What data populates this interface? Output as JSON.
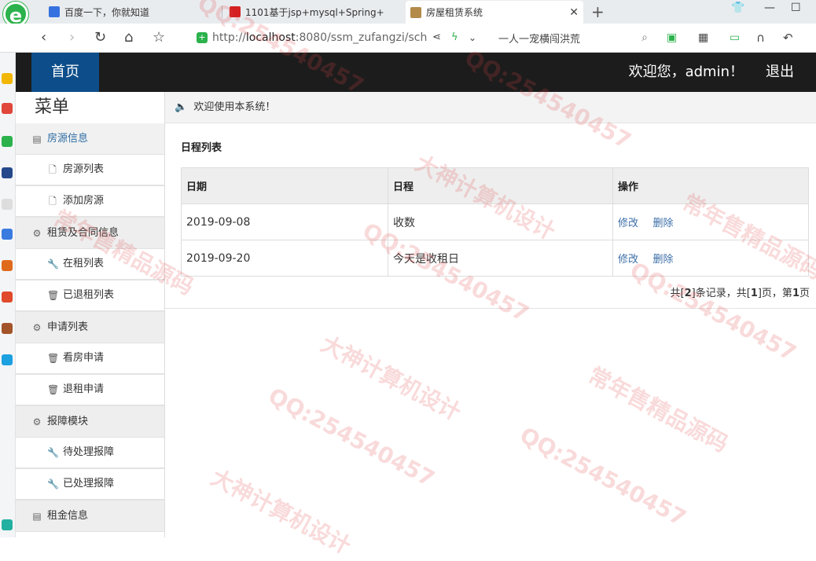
{
  "browser": {
    "tabs": [
      {
        "title": "百度一下，你就知道",
        "color": "#3572e0"
      },
      {
        "title": "1101基于jsp+mysql+Spring+",
        "color": "#d42020"
      },
      {
        "title": "房屋租赁系统",
        "color": "#b38a4a",
        "close": "✕"
      }
    ],
    "new_tab": "+",
    "url_prefix": "http://",
    "url_host": "localhost",
    "url_rest": ":8080/ssm_zufangzi/sch",
    "search_text": "一人一宠横闯洪荒"
  },
  "header": {
    "home": "首页",
    "welcome": "欢迎您，admin！",
    "logout": "退出"
  },
  "sidebar": {
    "title": "菜单",
    "groups": [
      {
        "label": "房源信息",
        "icon": "list-icon",
        "items": [
          {
            "label": "房源列表",
            "icon": "file-icon"
          },
          {
            "label": "添加房源",
            "icon": "file-icon"
          }
        ]
      },
      {
        "label": "租赁及合同信息",
        "icon": "gear-icon",
        "items": [
          {
            "label": "在租列表",
            "icon": "wrench-icon"
          },
          {
            "label": "已退租列表",
            "icon": "trash-icon"
          }
        ]
      },
      {
        "label": "申请列表",
        "icon": "gear-icon",
        "items": [
          {
            "label": "看房申请",
            "icon": "trash-icon"
          },
          {
            "label": "退租申请",
            "icon": "trash-icon"
          }
        ]
      },
      {
        "label": "报障模块",
        "icon": "gear-icon",
        "items": [
          {
            "label": "待处理报障",
            "icon": "wrench-icon"
          },
          {
            "label": "已处理报障",
            "icon": "wrench-icon"
          }
        ]
      },
      {
        "label": "租金信息",
        "icon": "list-icon",
        "items": []
      }
    ]
  },
  "notice": "欢迎使用本系统！",
  "main": {
    "title": "日程列表",
    "columns": [
      "日期",
      "日程",
      "操作"
    ],
    "rows": [
      {
        "date": "2019-09-08",
        "event": "收数",
        "edit": "修改",
        "delete": "删除"
      },
      {
        "date": "2019-09-20",
        "event": "今天是收租日",
        "edit": "修改",
        "delete": "删除"
      }
    ],
    "pager": {
      "p1": "共[",
      "total": "2",
      "p2": "]条记录，共[",
      "pages": "1",
      "p3": "]页，第",
      "current": "1",
      "p4": "页"
    }
  },
  "watermark": [
    "QQ:254540457",
    "大神计算机设计",
    "常年售精品源码"
  ]
}
